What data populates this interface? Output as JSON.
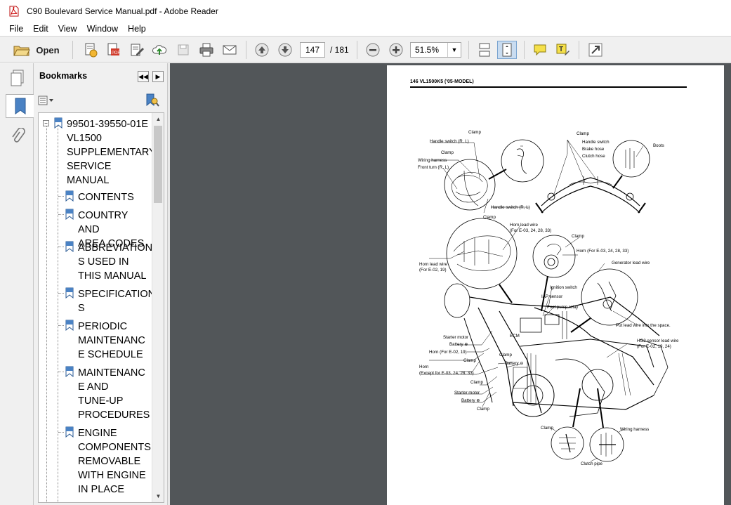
{
  "window": {
    "title": "C90 Boulevard Service Manual.pdf - Adobe Reader"
  },
  "menu": {
    "items": [
      "File",
      "Edit",
      "View",
      "Window",
      "Help"
    ]
  },
  "toolbar": {
    "open_label": "Open",
    "page_current": "147",
    "page_total": "/ 181",
    "zoom_value": "51.5%"
  },
  "bookmarks": {
    "title": "Bookmarks",
    "items": [
      "99501-39550-01E VL1500 SUPPLEMENTARY SERVICE MANUAL",
      "CONTENTS",
      "COUNTRY AND AREA CODES",
      "ABBREVIATIONS USED IN THIS MANUAL",
      "SPECIFICATIONS",
      "PERIODIC MAINTENANCE SCHEDULE",
      "MAINTENANCE AND TUNE-UP PROCEDURES",
      "ENGINE COMPONENTS REMOVABLE WITH ENGINE IN PLACE"
    ],
    "lines": [
      [
        "99501-39550-01E",
        "VL1500",
        "SUPPLEMENTARY",
        "SERVICE",
        "MANUAL"
      ],
      [
        "CONTENTS"
      ],
      [
        "COUNTRY AND",
        "AREA CODES"
      ],
      [
        "ABBREVIATION",
        "S USED IN",
        "THIS MANUAL"
      ],
      [
        "SPECIFICATION",
        "S"
      ],
      [
        "PERIODIC",
        "MAINTENANC",
        "E SCHEDULE"
      ],
      [
        "MAINTENANC",
        "E AND",
        "TUNE-UP",
        "PROCEDURES"
      ],
      [
        "ENGINE",
        "COMPONENTS",
        "REMOVABLE",
        "WITH ENGINE",
        "IN PLACE"
      ]
    ]
  },
  "document": {
    "page_header": "146    VL1500K5 ('05-MODEL)",
    "labels": {
      "clamp": "Clamp",
      "handle_switch_rl": "Handle switch (R, L)",
      "wiring_harness_lc": "Wiring harness",
      "front_turn_rl": "Front turn (R, L)",
      "handle_switch": "Handle switch",
      "brake_hose": "Brake hose",
      "clutch_hose": "Clutch hose",
      "boots": "Boots",
      "horn_lead_wire_1": "Horn lead wire",
      "horn_lead_wire_1b": "(For E-03, 24, 28, 33)",
      "horn_lead_wire_2": "Horn lead wire",
      "horn_lead_wire_2b": "(For E-02, 19)",
      "horn_for": "Horn (For E-03, 24, 28, 33)",
      "generator_lead_wire": "Generator lead wire",
      "ignition_switch": "Ignition switch",
      "iap_sensor": "IAP sensor",
      "fuel_pump_relay": "Fuel pump relay",
      "put_lead_wire": "Put lead wire into the space.",
      "ecm": "ECM",
      "starter_motor": "Starter motor",
      "battery_plus": "Battery ⊕",
      "horn_e02": "Horn (For E-02, 19)",
      "battery_minus": "Battery ⊖",
      "horn_except": "Horn",
      "horn_except_b": "(Except for E-03, 24, 28, 33)",
      "ho2_sensor": "HO2 sensor lead wire",
      "ho2_sensor_b": "(For E-02, 19, 24)",
      "wiring_harness": "Wiring harness",
      "clutch_pipe": "Clutch pipe"
    }
  },
  "colors": {
    "doc_background": "#525659",
    "panel_background": "#f0f0f0"
  }
}
